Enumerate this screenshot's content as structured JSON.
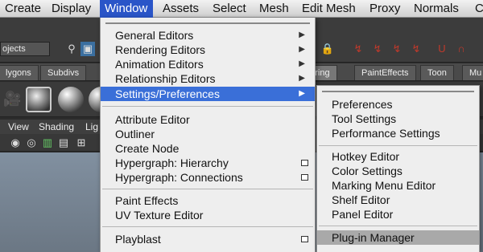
{
  "menubar": {
    "items": [
      "Create",
      "Display",
      "Window",
      "Assets",
      "Select",
      "Mesh",
      "Edit Mesh",
      "Proxy",
      "Normals",
      "C"
    ]
  },
  "toolbar": {
    "field_text": "ojects"
  },
  "shelf_tabs": [
    "lygons",
    "Subdivs",
    "dering",
    "PaintEffects",
    "Toon",
    "Mu"
  ],
  "view_menu": [
    "View",
    "Shading",
    "Lig"
  ],
  "window_menu": {
    "groups": [
      [
        {
          "label": "General Editors",
          "submenu": true
        },
        {
          "label": "Rendering Editors",
          "submenu": true
        },
        {
          "label": "Animation Editors",
          "submenu": true
        },
        {
          "label": "Relationship Editors",
          "submenu": true
        },
        {
          "label": "Settings/Preferences",
          "submenu": true,
          "highlighted": true
        }
      ],
      [
        {
          "label": "Attribute Editor"
        },
        {
          "label": "Outliner"
        },
        {
          "label": "Create Node"
        },
        {
          "label": "Hypergraph: Hierarchy",
          "option_box": true
        },
        {
          "label": "Hypergraph: Connections",
          "option_box": true
        }
      ],
      [
        {
          "label": "Paint Effects"
        },
        {
          "label": "UV Texture Editor"
        }
      ],
      [
        {
          "label": "Playblast",
          "option_box": true
        }
      ]
    ]
  },
  "settings_submenu": {
    "groups": [
      [
        "Preferences",
        "Tool Settings",
        "Performance Settings"
      ],
      [
        "Hotkey Editor",
        "Color Settings",
        "Marking Menu Editor",
        "Shelf Editor",
        "Panel Editor"
      ],
      [
        "Plug-in Manager"
      ]
    ],
    "hovered": "Plug-in Manager"
  },
  "colors": {
    "menu_highlight": "#3a6fd8",
    "menubar_active": "#2a55c8",
    "submenu_hover": "#a9a9a9"
  }
}
